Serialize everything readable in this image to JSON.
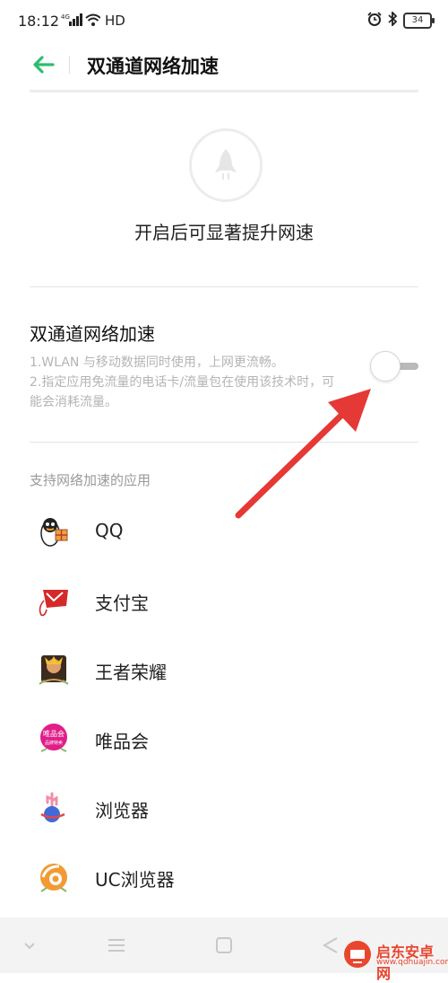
{
  "status_bar": {
    "time": "18:12",
    "network": "4G",
    "hd": "HD",
    "battery": "34"
  },
  "header": {
    "title": "双通道网络加速"
  },
  "hero": {
    "text": "开启后可显著提升网速"
  },
  "setting": {
    "title": "双通道网络加速",
    "desc_line1": "1.WLAN 与移动数据同时使用，上网更流畅。",
    "desc_line2": "2.指定应用免流量的电话卡/流量包在使用该技术时，可能会消耗流量。",
    "enabled": false
  },
  "section_title": "支持网络加速的应用",
  "apps": [
    {
      "label": "QQ",
      "icon": "qq-icon"
    },
    {
      "label": "支付宝",
      "icon": "alipay-icon"
    },
    {
      "label": "王者荣耀",
      "icon": "honor-of-kings-icon"
    },
    {
      "label": "唯品会",
      "icon": "vipshop-icon"
    },
    {
      "label": "浏览器",
      "icon": "browser-icon"
    },
    {
      "label": "UC浏览器",
      "icon": "uc-browser-icon"
    }
  ],
  "watermark": {
    "name": "启东安卓网",
    "url": "www.qdhuajin.com"
  },
  "colors": {
    "accent": "#2dbd6e",
    "annotation": "#e53935"
  }
}
